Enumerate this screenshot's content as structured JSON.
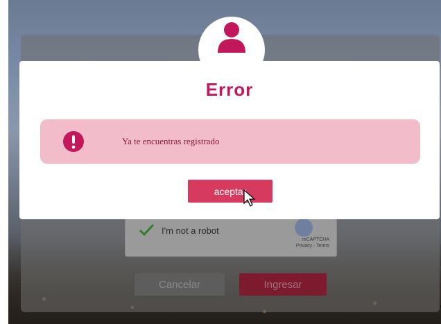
{
  "modal": {
    "title": "Error",
    "message": "Ya te encuentras registrado",
    "accept_label": "aceptar",
    "icons": {
      "avatar": "user-icon",
      "alert": "exclamation-icon"
    },
    "colors": {
      "title": "#c2185b",
      "alert_bg": "#f3bccb",
      "accept_bg": "#d63a5e"
    }
  },
  "login": {
    "recaptcha": {
      "label": "I'm not a robot",
      "brand": "reCAPTCHA",
      "links": "Privacy - Terms"
    },
    "cancel_label": "Cancelar",
    "submit_label": "Ingresar"
  }
}
